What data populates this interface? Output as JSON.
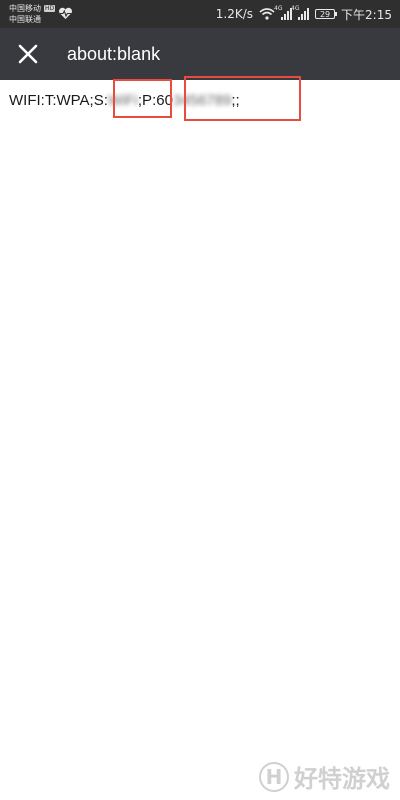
{
  "status_bar": {
    "carrier_1": "中国移动",
    "carrier_1_badge": "HD",
    "carrier_2": "中国联通",
    "network_speed": "1.2K/s",
    "signal_tag": "4G",
    "battery_level": "29",
    "time": "下午2:15"
  },
  "toolbar": {
    "title": "about:blank"
  },
  "content": {
    "prefix": "WIFI:T:WPA;S:",
    "ssid": "WiFi",
    "middle": ";P:",
    "password_start": "60",
    "password_rest": "3456789",
    "suffix": ";;"
  },
  "watermark": {
    "logo_letter": "H",
    "text": "好特游戏"
  }
}
